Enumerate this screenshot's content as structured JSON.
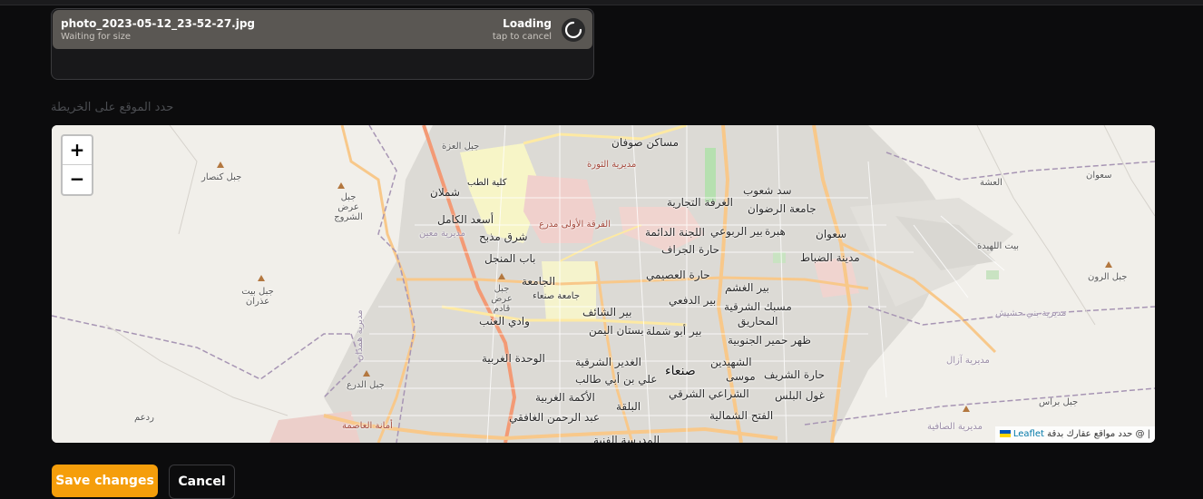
{
  "upload": {
    "file_name": "photo_2023-05-12_23-52-27.jpg",
    "file_sub": "Waiting for size",
    "status": "Loading",
    "hint": "tap to cancel",
    "spinner_icon": "loading-spinner-icon"
  },
  "map_label": "حدد الموقع على الخريطة",
  "map": {
    "zoom_in": "+",
    "zoom_out": "−",
    "attribution_text": "حدد مواقع عقارك بدقة @ |",
    "attribution_link": "Leaflet",
    "places": {
      "masakin_safwan": "مساكن صوفان",
      "thawra": "مديرية الثورة",
      "tib": "كلية الطب",
      "shamlan": "شملان",
      "asaad": "أسعد الكامل",
      "madbah": "شرق مذبح",
      "firqa": "الفرقة الأولى مدرع",
      "ghurfa": "الغرفة التجارية",
      "lajna": "اللجنة الدائمة",
      "jiraf": "حارة الجراف",
      "sad_shaoub": "سد شعوب",
      "ridwan": "جامعة الرضوان",
      "hirra": "هبرة",
      "rubuai": "بير الربوعي",
      "saawan": "سعوان",
      "dhabbat": "مدينة الضباط",
      "asimi": "حارة العصيمي",
      "jamia": "الجامعة",
      "jamiat_sanaa": "جامعة صنعاء",
      "dafai": "بير الدفعي",
      "ghashm": "بير الغشم",
      "masbak": "مسبك الشرقية",
      "mahariq": "المحاريق",
      "shaif": "بير الشائف",
      "yemen_garden": "بستان اليمن",
      "abu_shamla": "بير أبو شملة",
      "humair": "ظهر حمير الجنوبية",
      "anab": "وادي العنب",
      "wahda": "الوحدة الغربية",
      "ghadir": "الغدير الشرقية",
      "ali": "علي بن أبي طالب",
      "sanaa": "صنعاء",
      "shuhada": "الشهيدين",
      "musa": "موسى",
      "sharif": "حارة الشريف",
      "akama": "الأكمة الغربية",
      "shiraai": "الشراعي الشرقي",
      "bilis": "غول البلس",
      "balqa": "البلقة",
      "ghafiqi": "عبد الرحمن الغافقي",
      "fath": "الفتح الشمالية",
      "madrasa": "المدرسة الفنية",
      "nakhla": "باب المنجل",
      "kanasar": "جبل كنصار",
      "arad_shuruj": "جبل عرض الشروج",
      "maain": "مديرية معين",
      "beit_adhran": "جبل بيت عذران",
      "arad_qadim": "جبل عرض قادم",
      "hamdan": "مديرية همدان",
      "dara": "جبل الدرع",
      "radaa": "ردعم",
      "amana": "أمانة العاصمة",
      "izza": "جبل العزة",
      "ashsha": "العشة",
      "saawan_e": "سعوان",
      "lahida": "بيت اللهيدة",
      "rawn": "جبل الرون",
      "bani_hushaysh": "مديرية بني حشيش",
      "azal": "مديرية آزال",
      "baras": "جبل براس",
      "safia": "مديرية الصافية"
    }
  },
  "buttons": {
    "save": "Save changes",
    "cancel": "Cancel"
  },
  "colors": {
    "accent": "#f59e0b",
    "background": "#0c0c0d"
  }
}
